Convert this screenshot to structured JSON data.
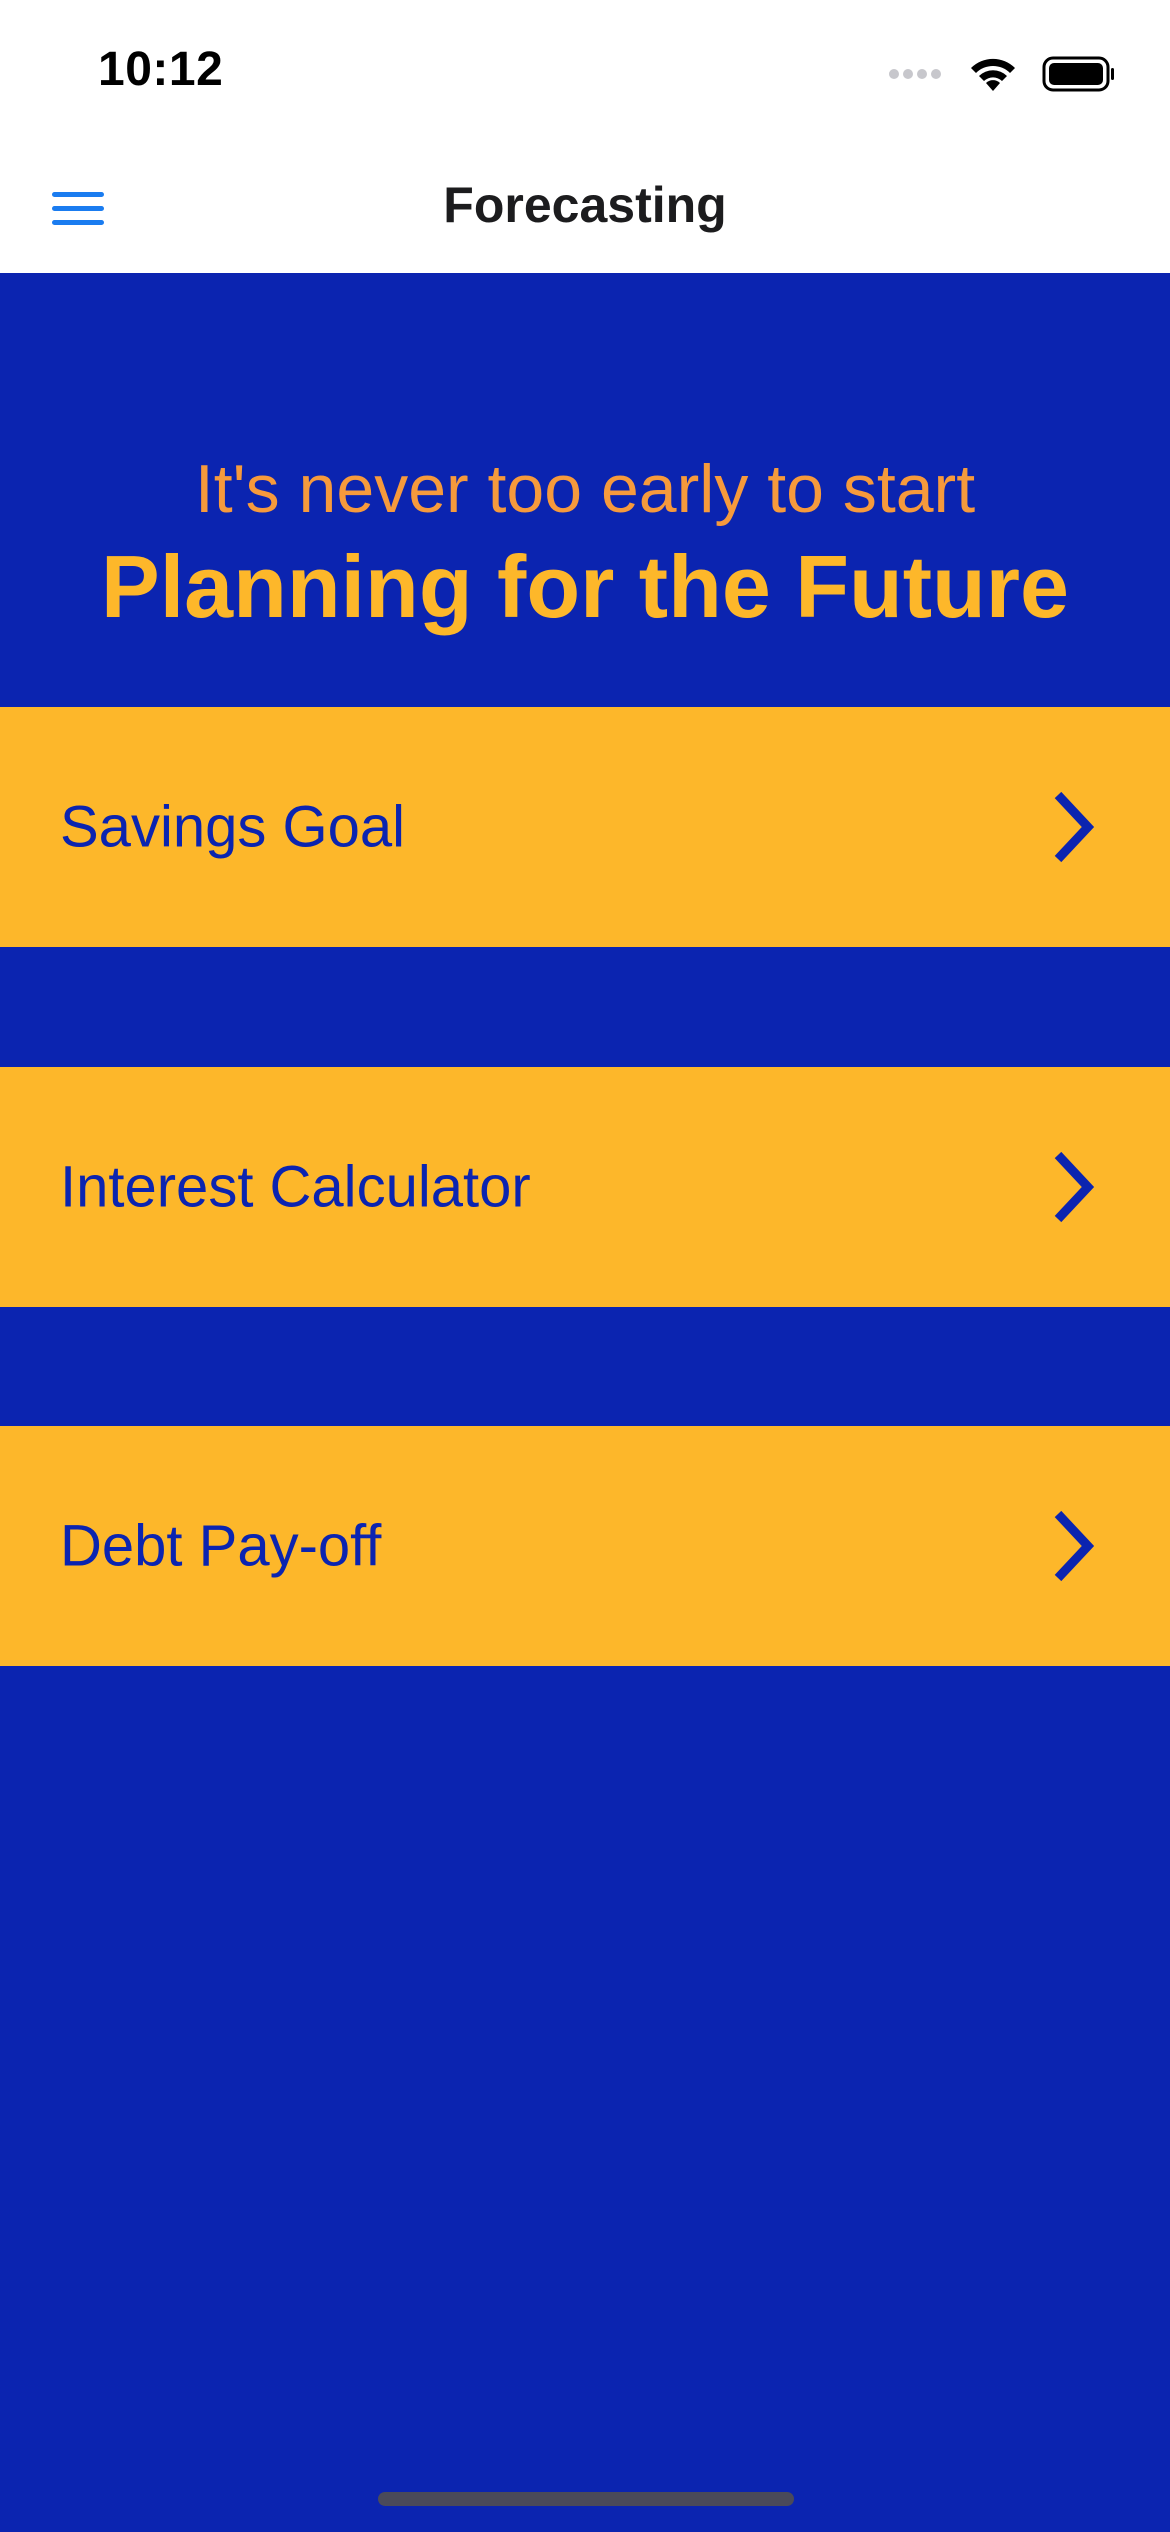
{
  "status_bar": {
    "time": "10:12"
  },
  "nav": {
    "title": "Forecasting",
    "menu_icon": "hamburger-menu-icon"
  },
  "hero": {
    "subtitle": "It's never too early to start",
    "title": "Planning for the Future"
  },
  "options": [
    {
      "label": "Savings Goal",
      "icon": "chevron-right-icon"
    },
    {
      "label": "Interest Calculator",
      "icon": "chevron-right-icon"
    },
    {
      "label": "Debt Pay-off",
      "icon": "chevron-right-icon"
    }
  ],
  "colors": {
    "background": "#0b24b0",
    "row_background": "#fdb72a",
    "hero_subtitle": "#f69a3c",
    "hero_title": "#fdb72a",
    "accent_blue": "#1a7cf0"
  }
}
